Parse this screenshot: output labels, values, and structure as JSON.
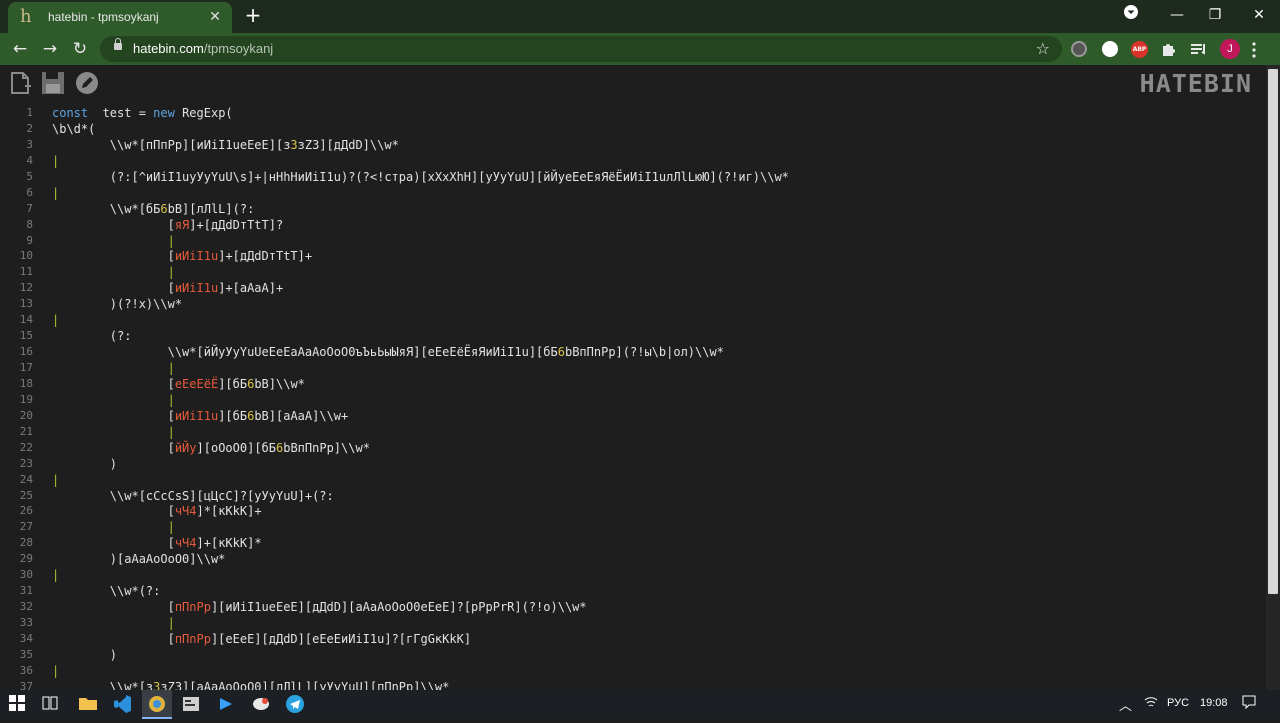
{
  "browser": {
    "tab_title": "hatebin - tpmsoykanj",
    "favicon_glyph": "h",
    "url_host": "hatebin.com",
    "url_path": "/tpmsoykanj",
    "avatar_letter": "J",
    "abp_label": "ABP"
  },
  "app": {
    "brand": "HATEBIN"
  },
  "code_lines": [
    {
      "n": "1",
      "t": [
        [
          "kw",
          "const"
        ],
        [
          "",
          "  test = "
        ],
        [
          "kw",
          "new"
        ],
        [
          "",
          " RegExp("
        ]
      ]
    },
    {
      "n": "2",
      "t": [
        [
          "",
          "\\b\\d*("
        ]
      ]
    },
    {
      "n": "3",
      "t": [
        [
          "",
          "\t\\\\w*[пПпРр][иИiI1uеЕeE][з"
        ],
        [
          "y",
          "3"
        ],
        [
          "",
          "зZ3][дДdD]\\\\w*"
        ]
      ]
    },
    {
      "n": "4",
      "t": [
        [
          "bar",
          "|"
        ]
      ]
    },
    {
      "n": "5",
      "t": [
        [
          "",
          "\t(?:[^иИiI1uуУyYuU\\s]+|нНhHиИiI1u)?(?<!стра)[хХxXhH][уУyYuU][йЙуеЕeEяЯёЁиИiI1uлЛlLюЮ](?!иг)\\\\w*"
        ]
      ]
    },
    {
      "n": "6",
      "t": [
        [
          "bar",
          "|"
        ]
      ]
    },
    {
      "n": "7",
      "t": [
        [
          "",
          "\t\\\\w*[бБ"
        ],
        [
          "y",
          "6"
        ],
        [
          "",
          "bB][лЛlL](?:"
        ]
      ]
    },
    {
      "n": "8",
      "t": [
        [
          "",
          "\t\t["
        ],
        [
          "r",
          "яЯ"
        ],
        [
          "",
          "]+[дДdDтТtT]?"
        ]
      ]
    },
    {
      "n": "9",
      "t": [
        [
          "",
          "\t\t"
        ],
        [
          "bar",
          "|"
        ]
      ]
    },
    {
      "n": "10",
      "t": [
        [
          "",
          "\t\t["
        ],
        [
          "r",
          "иИiI1u"
        ],
        [
          "",
          "]+[дДdDтТtT]+"
        ]
      ]
    },
    {
      "n": "11",
      "t": [
        [
          "",
          "\t\t"
        ],
        [
          "bar",
          "|"
        ]
      ]
    },
    {
      "n": "12",
      "t": [
        [
          "",
          "\t\t["
        ],
        [
          "r",
          "иИiI1u"
        ],
        [
          "",
          "]+[аАaA]+"
        ]
      ]
    },
    {
      "n": "13",
      "t": [
        [
          "",
          "\t)(?!х)\\\\w*"
        ]
      ]
    },
    {
      "n": "14",
      "t": [
        [
          "bar",
          "|"
        ]
      ]
    },
    {
      "n": "15",
      "t": [
        [
          "",
          "\t(?:"
        ]
      ]
    },
    {
      "n": "16",
      "t": [
        [
          "",
          "\t\t\\\\w*[йЙуУyYuUеЕeEаАaAоОoO0ъЪьЬыЫяЯ][еЕeEёЁяЯиИiI1u][бБ"
        ],
        [
          "y",
          "6"
        ],
        [
          "",
          "bBпПnPр](?!ы\\b|ол)\\\\w*"
        ]
      ]
    },
    {
      "n": "17",
      "t": [
        [
          "",
          "\t\t"
        ],
        [
          "bar",
          "|"
        ]
      ]
    },
    {
      "n": "18",
      "t": [
        [
          "",
          "\t\t["
        ],
        [
          "r",
          "еЕeEёЁ"
        ],
        [
          "",
          "][бБ"
        ],
        [
          "y",
          "6"
        ],
        [
          "",
          "bB]\\\\w*"
        ]
      ]
    },
    {
      "n": "19",
      "t": [
        [
          "",
          "\t\t"
        ],
        [
          "bar",
          "|"
        ]
      ]
    },
    {
      "n": "20",
      "t": [
        [
          "",
          "\t\t["
        ],
        [
          "r",
          "иИiI1u"
        ],
        [
          "",
          "][бБ"
        ],
        [
          "y",
          "6"
        ],
        [
          "",
          "bB][аАaA]\\\\w+"
        ]
      ]
    },
    {
      "n": "21",
      "t": [
        [
          "",
          "\t\t"
        ],
        [
          "bar",
          "|"
        ]
      ]
    },
    {
      "n": "22",
      "t": [
        [
          "",
          "\t\t["
        ],
        [
          "r",
          "йЙу"
        ],
        [
          "",
          "][оОoO0][бБ"
        ],
        [
          "y",
          "6"
        ],
        [
          "",
          "bBпПnPр]\\\\w*"
        ]
      ]
    },
    {
      "n": "23",
      "t": [
        [
          "",
          "\t)"
        ]
      ]
    },
    {
      "n": "24",
      "t": [
        [
          "bar",
          "|"
        ]
      ]
    },
    {
      "n": "25",
      "t": [
        [
          "",
          "\t\\\\w*[сСcCsS][цЦcC]?[уУyYuU]+(?:"
        ]
      ]
    },
    {
      "n": "26",
      "t": [
        [
          "",
          "\t\t["
        ],
        [
          "r",
          "чЧ4"
        ],
        [
          "",
          "]*[кКkK]+"
        ]
      ]
    },
    {
      "n": "27",
      "t": [
        [
          "",
          "\t\t"
        ],
        [
          "bar",
          "|"
        ]
      ]
    },
    {
      "n": "28",
      "t": [
        [
          "",
          "\t\t["
        ],
        [
          "r",
          "чЧ4"
        ],
        [
          "",
          "]+[кКkK]*"
        ]
      ]
    },
    {
      "n": "29",
      "t": [
        [
          "",
          "\t)[аАaAоОoO0]\\\\w*"
        ]
      ]
    },
    {
      "n": "30",
      "t": [
        [
          "bar",
          "|"
        ]
      ]
    },
    {
      "n": "31",
      "t": [
        [
          "",
          "\t\\\\w*(?:"
        ]
      ]
    },
    {
      "n": "32",
      "t": [
        [
          "",
          "\t\t["
        ],
        [
          "r",
          "пПnPр"
        ],
        [
          "",
          "][иИiI1uеЕeE][дДdD][аАaAоОoO0еЕeE]?[рPpPrR](?!о)\\\\w*"
        ]
      ]
    },
    {
      "n": "33",
      "t": [
        [
          "",
          "\t\t"
        ],
        [
          "bar",
          "|"
        ]
      ]
    },
    {
      "n": "34",
      "t": [
        [
          "",
          "\t\t["
        ],
        [
          "r",
          "пПnPр"
        ],
        [
          "",
          "][еЕeE][дДdD][еЕeEиИiI1u]?[гГgGкКkK]"
        ]
      ]
    },
    {
      "n": "35",
      "t": [
        [
          "",
          "\t)"
        ]
      ]
    },
    {
      "n": "36",
      "t": [
        [
          "bar",
          "|"
        ]
      ]
    },
    {
      "n": "37",
      "t": [
        [
          "",
          "\t\\\\w*[з"
        ],
        [
          "y",
          "3"
        ],
        [
          "",
          "зZ3][аАaAоОoO0][лЛlL][уУyYuU][пПnPр]\\\\w*"
        ]
      ]
    }
  ],
  "taskbar": {
    "lang": "РУС",
    "time": "19:08"
  },
  "colors": {
    "tab_green": "#2f5a2a",
    "keyword": "#5ea3e0",
    "highlight_red": "#e65a3a",
    "highlight_yellow": "#d8c24a",
    "pipe_green": "#a6c832"
  }
}
